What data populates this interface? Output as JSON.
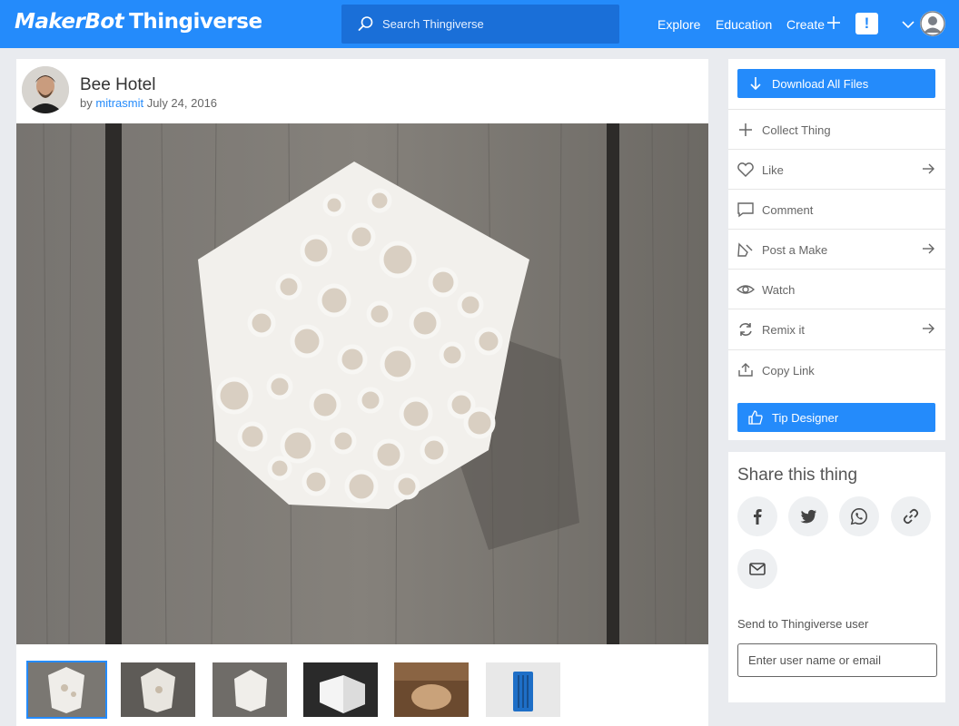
{
  "header": {
    "logo_brand": "MakerBot",
    "logo_product": "Thingiverse",
    "search_placeholder": "Search Thingiverse",
    "nav": [
      "Explore",
      "Education",
      "Create"
    ],
    "alert_label": "!",
    "colors": {
      "brand": "#248bfb",
      "search_bg": "#1a6fd8"
    }
  },
  "thing": {
    "title": "Bee Hotel",
    "by": "by",
    "author": "mitrasmit",
    "date": "July 24, 2016"
  },
  "sidebar": {
    "download_label": "Download All Files",
    "actions": [
      {
        "label": "Collect Thing",
        "icon": "plus-icon",
        "arrow": false
      },
      {
        "label": "Like",
        "icon": "heart-icon",
        "arrow": true
      },
      {
        "label": "Comment",
        "icon": "comment-icon",
        "arrow": false
      },
      {
        "label": "Post a Make",
        "icon": "make-icon",
        "arrow": true
      },
      {
        "label": "Watch",
        "icon": "eye-icon",
        "arrow": false
      },
      {
        "label": "Remix it",
        "icon": "remix-icon",
        "arrow": true
      },
      {
        "label": "Copy Link",
        "icon": "share-icon",
        "arrow": false
      }
    ],
    "tip_label": "Tip Designer"
  },
  "share": {
    "title": "Share this thing",
    "buttons": [
      "facebook-icon",
      "twitter-icon",
      "whatsapp-icon",
      "link-icon",
      "email-icon"
    ],
    "send_label": "Send to Thingiverse user",
    "send_placeholder": "Enter user name or email"
  }
}
